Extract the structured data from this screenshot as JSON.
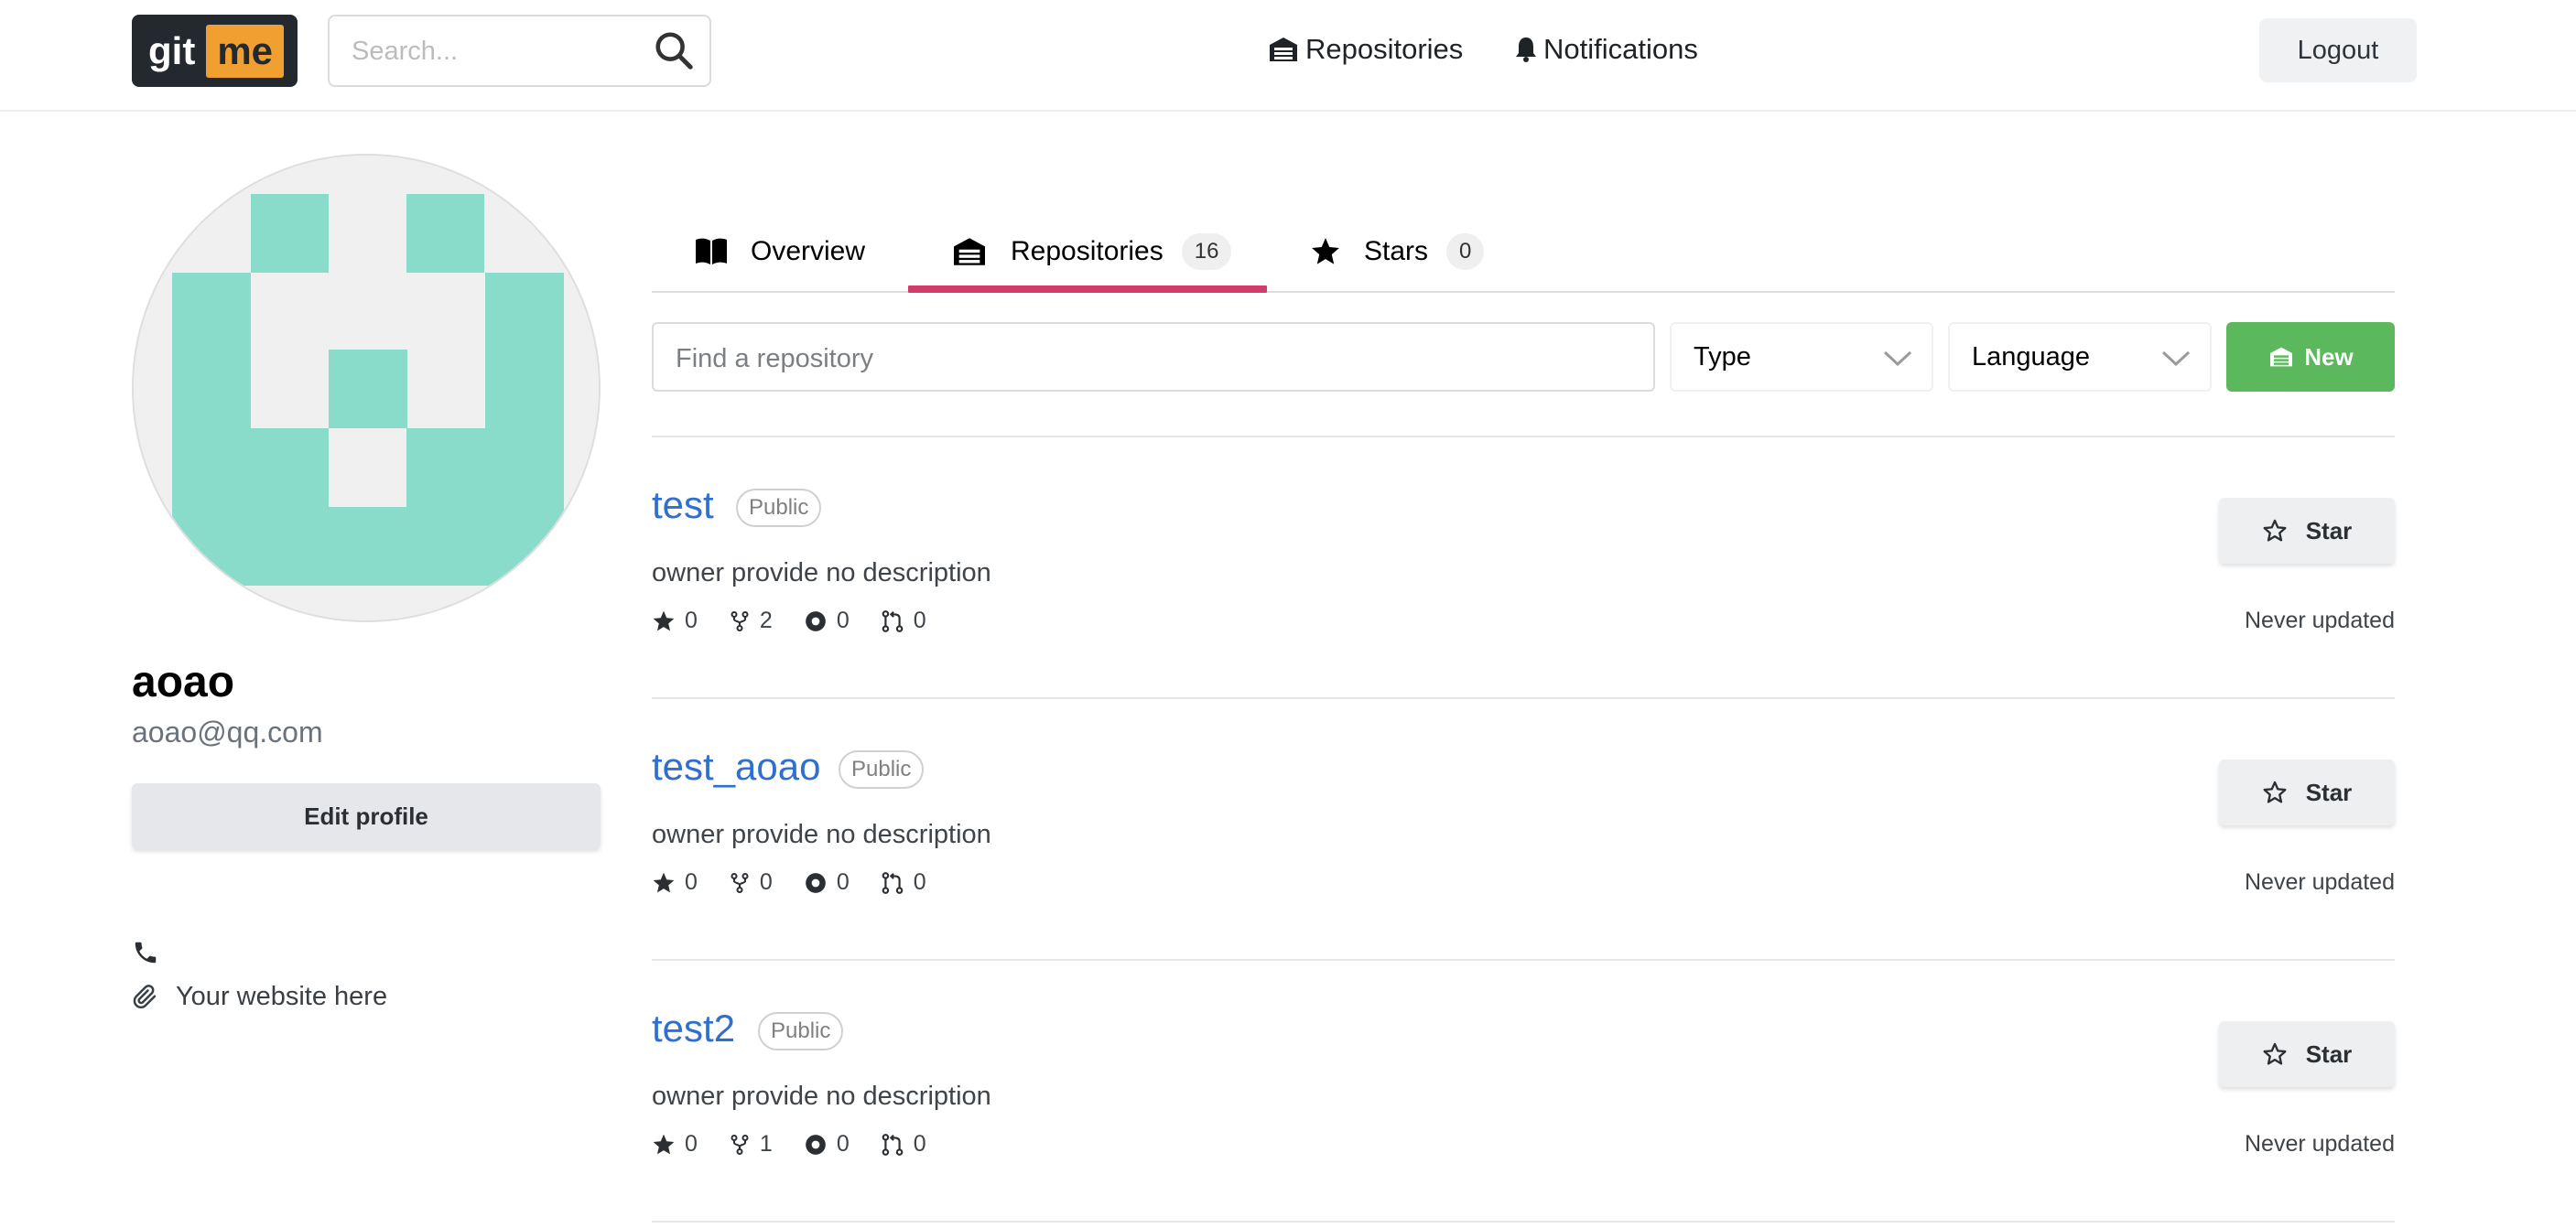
{
  "header": {
    "logo_left": "git",
    "logo_right": "me",
    "search_placeholder": "Search...",
    "nav_repositories": "Repositories",
    "nav_notifications": "Notifications",
    "logout": "Logout"
  },
  "profile": {
    "username": "aoao",
    "email": "aoao@qq.com",
    "edit_profile": "Edit profile",
    "website": "Your website here"
  },
  "tabs": {
    "overview": "Overview",
    "repositories": "Repositories",
    "repositories_count": "16",
    "stars": "Stars",
    "stars_count": "0"
  },
  "filters": {
    "find_placeholder": "Find a repository",
    "type": "Type",
    "language": "Language",
    "new": "New"
  },
  "repos": [
    {
      "name": "test",
      "visibility": "Public",
      "description": "owner provide no description",
      "stars": "0",
      "forks": "2",
      "issues": "0",
      "pulls": "0",
      "star_label": "Star",
      "updated": "Never updated"
    },
    {
      "name": "test_aoao",
      "visibility": "Public",
      "description": "owner provide no description",
      "stars": "0",
      "forks": "0",
      "issues": "0",
      "pulls": "0",
      "star_label": "Star",
      "updated": "Never updated"
    },
    {
      "name": "test2",
      "visibility": "Public",
      "description": "owner provide no description",
      "stars": "0",
      "forks": "1",
      "issues": "0",
      "pulls": "0",
      "star_label": "Star",
      "updated": "Never updated"
    }
  ],
  "colors": {
    "accent_tab": "#d23c6a",
    "new_button": "#5cb85c",
    "repo_link": "#2f6fce",
    "avatar_fill": "#8adcca"
  }
}
